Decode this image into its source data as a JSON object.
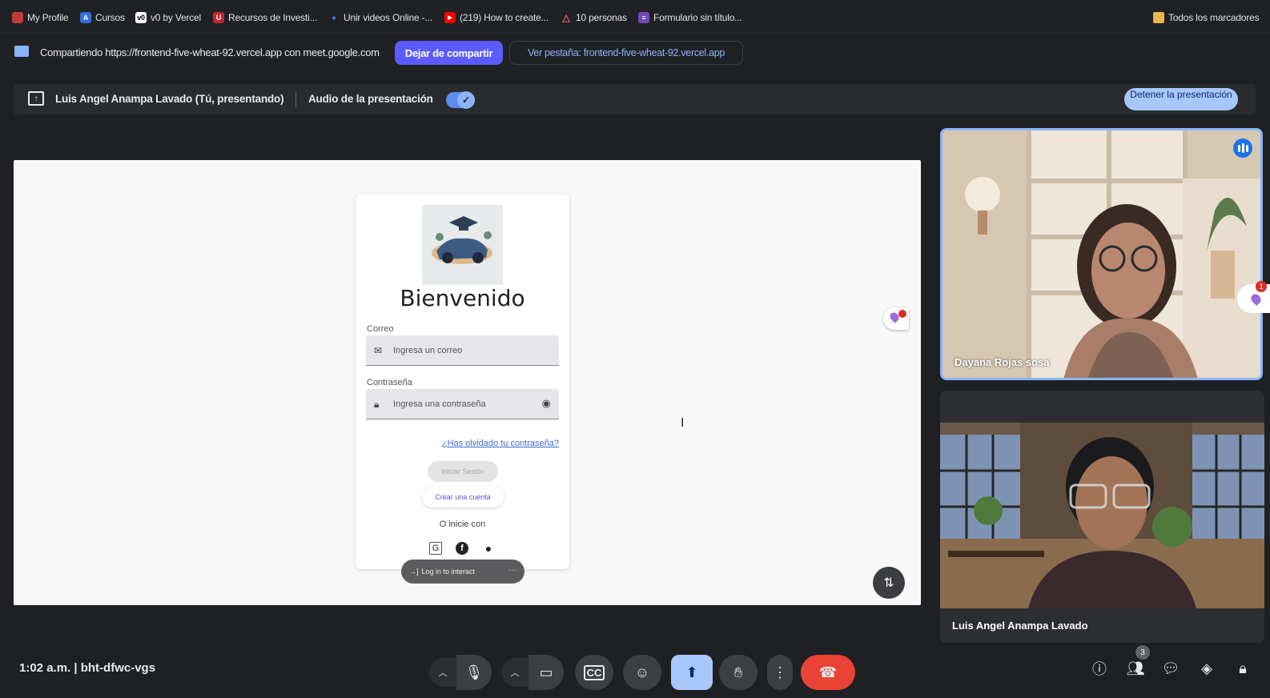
{
  "bookmarks": [
    {
      "label": "My Profile",
      "icon": "profile-icon",
      "color": "#c23b3b"
    },
    {
      "label": "Cursos",
      "icon": "cursos-icon",
      "color": "#2f6fe0"
    },
    {
      "label": "v0 by Vercel",
      "icon": "v0-icon",
      "color": "#000000"
    },
    {
      "label": "Recursos de Investi...",
      "icon": "recursos-icon",
      "color": "#c4262e"
    },
    {
      "label": "Unir videos Online -...",
      "icon": "unir-icon",
      "color": "#4285f4"
    },
    {
      "label": "(219) How to create...",
      "icon": "youtube-icon",
      "color": "#ff0000"
    },
    {
      "label": "10 personas",
      "icon": "airbnb-icon",
      "color": "#ff5a5f"
    },
    {
      "label": "Formulario sin título...",
      "icon": "forms-icon",
      "color": "#7248b9"
    },
    {
      "label": "Todos los marcadores",
      "icon": "folder-icon",
      "color": "#e8b64c"
    }
  ],
  "share": {
    "text": "Compartiendo https://frontend-five-wheat-92.vercel.app con meet.google.com",
    "stop_label": "Dejar de compartir",
    "view_tab_label": "Ver pestaña: frontend-five-wheat-92.vercel.app"
  },
  "presenting": {
    "name": "Luis Angel Anampa Lavado (Tú, presentando)",
    "audio_label": "Audio de la presentación",
    "audio_on": true,
    "stop_label": "Detener la presentación"
  },
  "login": {
    "title": "Bienvenido",
    "email_label": "Correo",
    "email_placeholder": "Ingresa un correo",
    "password_label": "Contraseña",
    "password_placeholder": "Ingresa una contraseña",
    "forgot_link": "¿Has olvidado tu contraseña?",
    "login_button": "Iniciar Sesión",
    "signup_button": "Crear una cuenta",
    "or_text": "O inicie con",
    "vercel_toolbar": "Log in to interact",
    "vercel_more": "···"
  },
  "participants": [
    {
      "name": "Dayana Rojas sosa",
      "speaking": true
    },
    {
      "name": "Luis Angel Anampa Lavado",
      "speaking": false
    }
  ],
  "side_pin_count": "1",
  "bottom": {
    "time_code": "1:02 a.m.  |  bht-dfwc-vgs",
    "people_count": "3"
  },
  "colors": {
    "accent": "#5b5bff",
    "stop_present": "#a8c7fa",
    "end_call": "#ea4335",
    "present_active": "#a8c7fa"
  }
}
